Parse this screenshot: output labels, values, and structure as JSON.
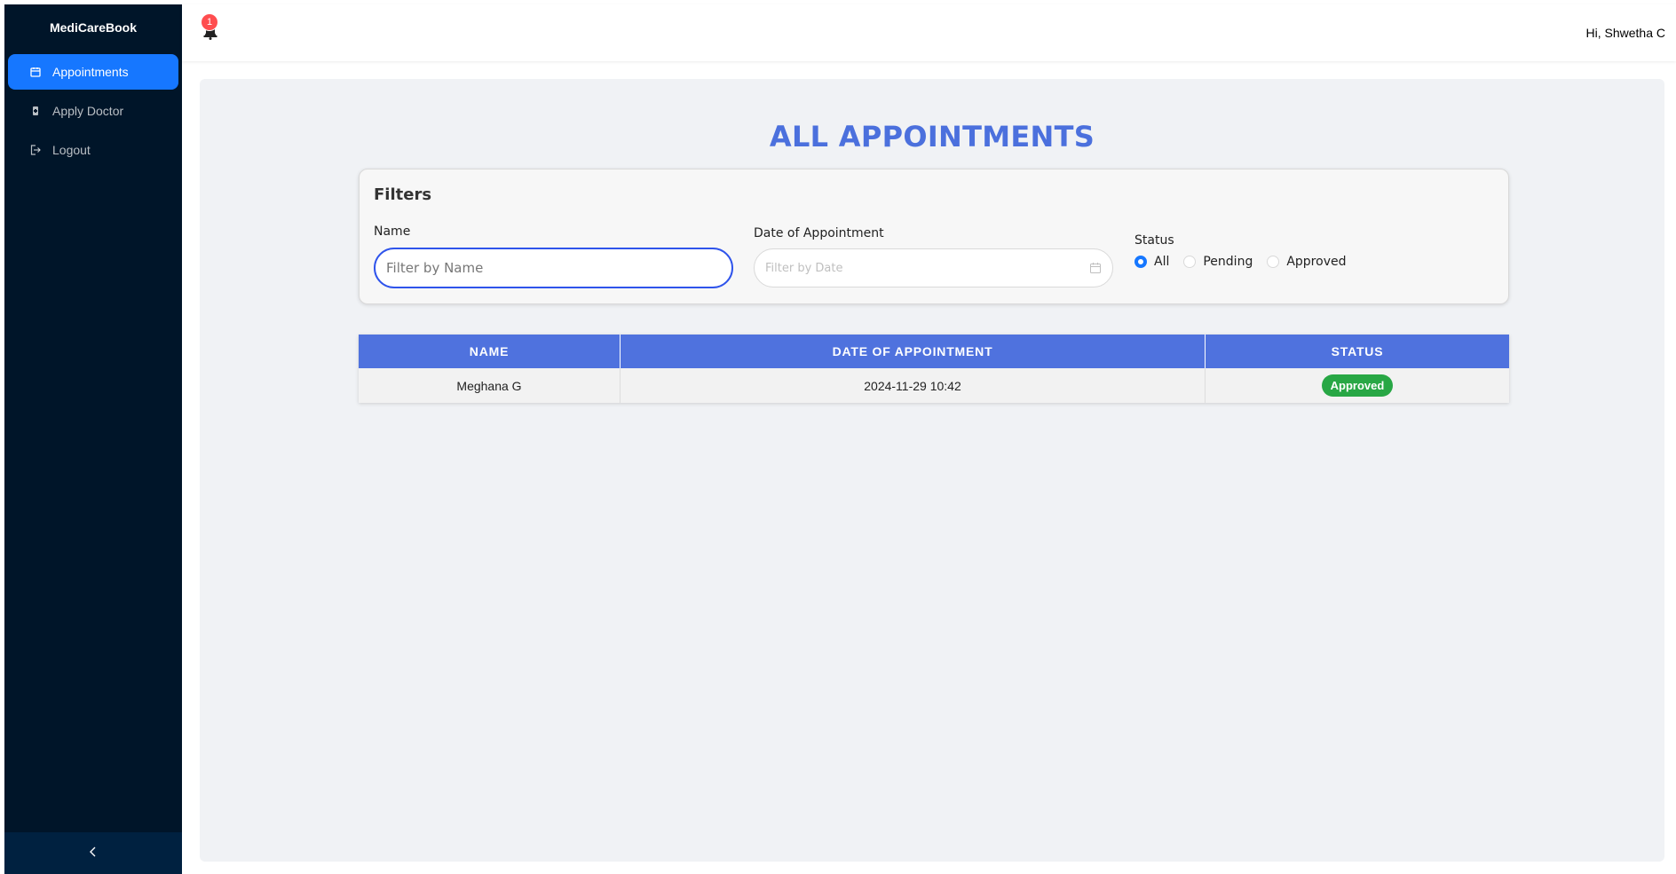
{
  "sidebar": {
    "brand": "MediCareBook",
    "items": [
      {
        "label": "Appointments",
        "icon": "calendar-icon",
        "active": true
      },
      {
        "label": "Apply Doctor",
        "icon": "doctor-icon",
        "active": false
      },
      {
        "label": "Logout",
        "icon": "logout-icon",
        "active": false
      }
    ],
    "collapse_icon": "chevron-left-icon"
  },
  "header": {
    "notification_count": "1",
    "greeting": "Hi, Shwetha C"
  },
  "main": {
    "title": "ALL APPOINTMENTS",
    "filters": {
      "title": "Filters",
      "name_label": "Name",
      "name_placeholder": "Filter by Name",
      "name_value": "",
      "date_label": "Date of Appointment",
      "date_placeholder": "Filter by Date",
      "date_value": "",
      "status_label": "Status",
      "status_options": [
        "All",
        "Pending",
        "Approved"
      ],
      "status_selected": "All"
    },
    "table": {
      "columns": [
        "NAME",
        "DATE OF APPOINTMENT",
        "STATUS"
      ],
      "rows": [
        {
          "name": "Meghana G",
          "date": "2024-11-29 10:42",
          "status": "Approved"
        }
      ]
    }
  },
  "colors": {
    "sidebar_bg": "#001529",
    "active_item": "#1677ff",
    "title": "#4b70dd",
    "table_header": "#4f72de",
    "status_approved": "#28a745",
    "badge": "#ff4d4f"
  }
}
